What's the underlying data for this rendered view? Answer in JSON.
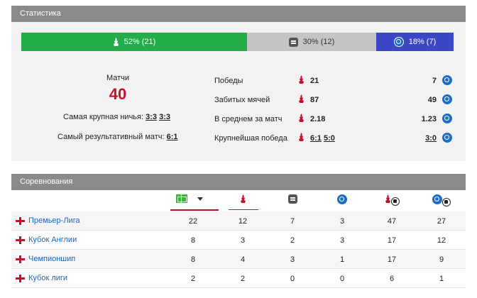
{
  "stats_header": "Статистика",
  "bar": {
    "home_pct": "52% (21)",
    "draw_pct": "30% (12)",
    "away_pct": "18% (7)",
    "home_share": 0.52,
    "draw_share": 0.3,
    "away_share": 0.18
  },
  "matches_label": "Матчи",
  "matches_value": "40",
  "biggest_draw_label": "Самая крупная ничья:",
  "biggest_draw_values": [
    "3:3",
    "3:3"
  ],
  "most_goals_label": "Самый результативный матч:",
  "most_goals_value": "6:1",
  "stats_rows": [
    {
      "label": "Победы",
      "home": [
        "21"
      ],
      "away": [
        "7"
      ]
    },
    {
      "label": "Забитых мячей",
      "home": [
        "87"
      ],
      "away": [
        "49"
      ]
    },
    {
      "label": "В среднем за матч",
      "home": [
        "2.18"
      ],
      "away": [
        "1.23"
      ]
    },
    {
      "label": "Крупнейшая победа",
      "home": [
        "6:1",
        "5:0"
      ],
      "away": [
        "3:0"
      ],
      "linked": true
    }
  ],
  "competitions_header": "Соревнования",
  "columns_icons": [
    "fields-icon",
    "liverpool-icon",
    "draw-icon",
    "brighton-icon",
    "liverpool-goals-icon",
    "brighton-goals-icon"
  ],
  "competitions": [
    {
      "name": "Премьер-Лига",
      "values": [
        "22",
        "12",
        "7",
        "3",
        "47",
        "27"
      ]
    },
    {
      "name": "Кубок Англии",
      "values": [
        "8",
        "3",
        "2",
        "3",
        "17",
        "12"
      ]
    },
    {
      "name": "Чемпионшип",
      "values": [
        "8",
        "4",
        "3",
        "1",
        "17",
        "9"
      ]
    },
    {
      "name": "Кубок лиги",
      "values": [
        "2",
        "2",
        "0",
        "0",
        "6",
        "1"
      ]
    }
  ],
  "colors": {
    "home": "#22ad4a",
    "draw": "#c5c5c5",
    "away": "#3c47c5",
    "accent": "#c8102e",
    "link": "#1565c0"
  }
}
